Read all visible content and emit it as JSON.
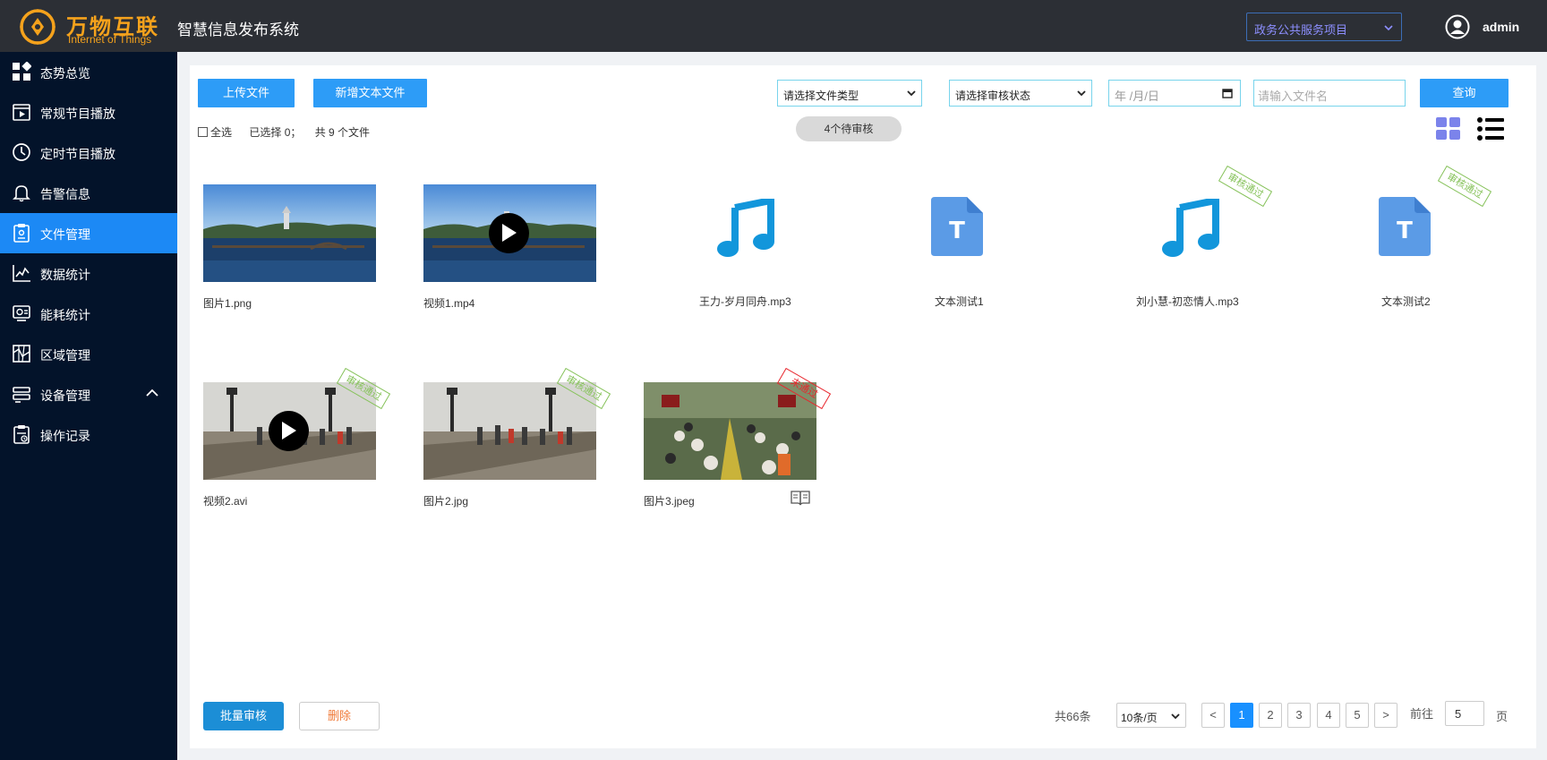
{
  "header": {
    "logo_cn": "万物互联",
    "logo_en": "Internet of Things",
    "system_title": "智慧信息发布系统",
    "project_select": "政务公共服务项目",
    "username": "admin"
  },
  "sidebar": {
    "items": [
      {
        "label": "态势总览",
        "icon": "dashboard-icon"
      },
      {
        "label": "常规节目播放",
        "icon": "play-program-icon"
      },
      {
        "label": "定时节目播放",
        "icon": "clock-icon"
      },
      {
        "label": "告警信息",
        "icon": "bell-icon"
      },
      {
        "label": "文件管理",
        "icon": "file-management-icon",
        "active": true
      },
      {
        "label": "数据统计",
        "icon": "chart-line-icon"
      },
      {
        "label": "能耗统计",
        "icon": "energy-icon"
      },
      {
        "label": "区域管理",
        "icon": "map-icon"
      },
      {
        "label": "设备管理",
        "icon": "device-icon",
        "expandable": true
      },
      {
        "label": "操作记录",
        "icon": "operation-log-icon"
      }
    ]
  },
  "toolbar": {
    "upload_label": "上传文件",
    "new_text_label": "新增文本文件",
    "file_type_select": "请选择文件类型",
    "audit_status_select": "请选择审核状态",
    "date_placeholder": "年 /月/日",
    "filename_placeholder": "请输入文件名",
    "query_label": "查询"
  },
  "selection": {
    "select_all": "全选",
    "selected_text": "已选择 0；",
    "total_files_text": "共 9 个文件",
    "pending_badge": "4个待审核"
  },
  "files": [
    {
      "name": "图片1.png",
      "type": "image"
    },
    {
      "name": "视频1.mp4",
      "type": "video"
    },
    {
      "name": "王力-岁月同舟.mp3",
      "type": "audio"
    },
    {
      "name": "文本测试1",
      "type": "text"
    },
    {
      "name": "刘小慧-初恋情人.mp3",
      "type": "audio",
      "stamp": "审核通过"
    },
    {
      "name": "文本测试2",
      "type": "text",
      "stamp": "审核通过"
    },
    {
      "name": "视频2.avi",
      "type": "video",
      "stamp": "审核通过"
    },
    {
      "name": "图片2.jpg",
      "type": "image",
      "stamp": "审核通过"
    },
    {
      "name": "图片3.jpeg",
      "type": "image",
      "stamp": "未通过"
    }
  ],
  "footer": {
    "batch_audit_label": "批量审核",
    "delete_label": "删除",
    "total_text": "共66条",
    "page_size": "10条/页",
    "pages": [
      "1",
      "2",
      "3",
      "4",
      "5"
    ],
    "current_page": "1",
    "prev": "<",
    "next": ">",
    "goto_label": "前往",
    "goto_value": "5",
    "page_unit": "页"
  },
  "colors": {
    "header_bg": "#2c2f35",
    "sidebar_bg": "#03132a",
    "active_blue": "#1c89f5",
    "button_blue": "#2d9cf7",
    "brand_orange": "#f5a21c",
    "approved_green": "#86c25a",
    "rejected_red": "#e8262d",
    "audio_blue": "#1296db",
    "text_doc_blue": "#5b9be6"
  }
}
